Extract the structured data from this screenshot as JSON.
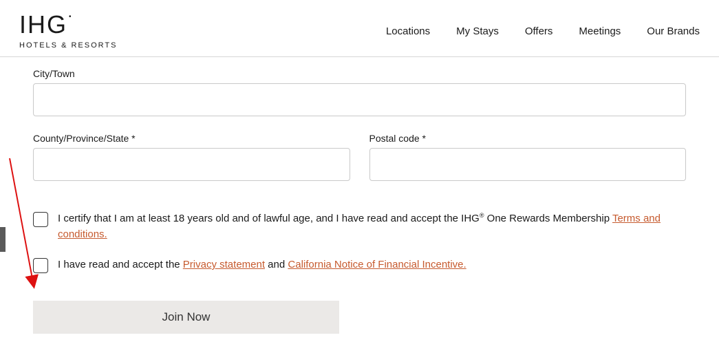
{
  "header": {
    "logo_main": "IHG",
    "logo_sub": "HOTELS & RESORTS"
  },
  "nav": {
    "locations": "Locations",
    "mystays": "My Stays",
    "offers": "Offers",
    "meetings": "Meetings",
    "brands": "Our Brands"
  },
  "form": {
    "city_label": "City/Town",
    "city_value": "",
    "state_label": "County/Province/State *",
    "state_value": "",
    "postal_label": "Postal code *",
    "postal_value": ""
  },
  "consent": {
    "age_pre": "I certify that I am at least 18 years old and of lawful age, and I have read and accept the IHG",
    "age_post": " One Rewards Membership ",
    "terms_link": "Terms and conditions.",
    "privacy_pre": "I have read and accept the ",
    "privacy_link": "Privacy statement",
    "privacy_mid": " and ",
    "california_link": "California Notice of Financial Incentive."
  },
  "cta": {
    "join": "Join Now"
  }
}
